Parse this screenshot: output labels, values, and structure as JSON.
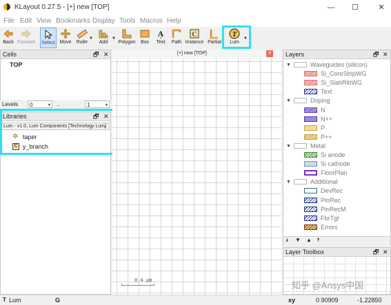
{
  "window": {
    "title": "KLayout 0.27.5 - [+] new [TOP]",
    "min": "—",
    "max": "☐",
    "close": "✕"
  },
  "menu": [
    "File",
    "Edit",
    "View",
    "Bookmarks",
    "Display",
    "Tools",
    "Macros",
    "Help"
  ],
  "toolbar": {
    "back": "Back",
    "forward": "Forward",
    "select": "Select",
    "move": "Move",
    "ruler": "Ruler",
    "add": "Add",
    "polygon": "Polygon",
    "box": "Box",
    "text": "Text",
    "path": "Path",
    "instance": "Instance",
    "partial": "Partial",
    "lum": "Lum"
  },
  "cells": {
    "title": "Cells",
    "items": [
      "TOP"
    ],
    "levels_label": "Levels",
    "level_from": "0",
    "level_sep": "..",
    "level_to": "1"
  },
  "libraries": {
    "title": "Libraries",
    "selected": "Lum - v1.0, Lum Components [Technology Lum]",
    "items": [
      "taper",
      "y_branch"
    ]
  },
  "canvas": {
    "tab": "[+] new [TOP]",
    "scale_label": "0.4 µm"
  },
  "layers": {
    "title": "Layers",
    "rows": [
      {
        "name": "Waveguides (silicon)",
        "group": true,
        "swatch": "#ffffff",
        "border": "#b8b8b8",
        "pattern": "none"
      },
      {
        "name": "Si_CoreStripWG",
        "group": false,
        "swatch": "#f6c2c2",
        "border": "#e07070",
        "pattern": "cross"
      },
      {
        "name": "Si_SlabRibWG",
        "group": false,
        "swatch": "#f6c2c2",
        "border": "#e07070",
        "pattern": "diag"
      },
      {
        "name": "Text",
        "group": false,
        "swatch": "#ffffff",
        "border": "#1c2f8a",
        "pattern": "diag-blue"
      },
      {
        "name": "Doping",
        "group": true,
        "swatch": "#ffffff",
        "border": "#b8b8b8",
        "pattern": "none"
      },
      {
        "name": "N",
        "group": false,
        "swatch": "#b3a3e0",
        "border": "#6548b7",
        "pattern": "diag"
      },
      {
        "name": "N++",
        "group": false,
        "swatch": "#9d8bdd",
        "border": "#4b3aa3",
        "pattern": "solid"
      },
      {
        "name": "P",
        "group": false,
        "swatch": "#f4d9a6",
        "border": "#d49d44",
        "pattern": "solid"
      },
      {
        "name": "P++",
        "group": false,
        "swatch": "#f1dca8",
        "border": "#c9a04b",
        "pattern": "diag"
      },
      {
        "name": "Metal",
        "group": true,
        "swatch": "#ffffff",
        "border": "#b8b8b8",
        "pattern": "none"
      },
      {
        "name": "Si anode",
        "group": false,
        "swatch": "#cfe9c8",
        "border": "#3b8b2e",
        "pattern": "diag"
      },
      {
        "name": "Si cathode",
        "group": false,
        "swatch": "#d9e6f6",
        "border": "#6f90c2",
        "pattern": "dots"
      },
      {
        "name": "FloorPlan",
        "group": false,
        "swatch": "#ffffff",
        "border": "#7a2bbf",
        "pattern": "thick"
      },
      {
        "name": "Additional",
        "group": true,
        "swatch": "#ffffff",
        "border": "#b8b8b8",
        "pattern": "none"
      },
      {
        "name": "DevRec",
        "group": false,
        "swatch": "#ffffff",
        "border": "#2c6a8b",
        "pattern": "none"
      },
      {
        "name": "PinRec",
        "group": false,
        "swatch": "#ffffff",
        "border": "#1c2f8a",
        "pattern": "diag-blue"
      },
      {
        "name": "PinRecM",
        "group": false,
        "swatch": "#ffffff",
        "border": "#1c2f8a",
        "pattern": "diag-blue"
      },
      {
        "name": "FbrTgt",
        "group": false,
        "swatch": "#ffffff",
        "border": "#1c2f8a",
        "pattern": "diag-blue"
      },
      {
        "name": "Errors",
        "group": false,
        "swatch": "#f0c78d",
        "border": "#7a3b00",
        "pattern": "diag-dark"
      }
    ]
  },
  "layer_toolbox": {
    "title": "Layer Toolbox",
    "watermark": "知乎 @Ansys中国"
  },
  "status": {
    "mode": "Lum",
    "g": "G",
    "xy_label": "xy",
    "x": "0.90909",
    "y": "-1.22850"
  }
}
